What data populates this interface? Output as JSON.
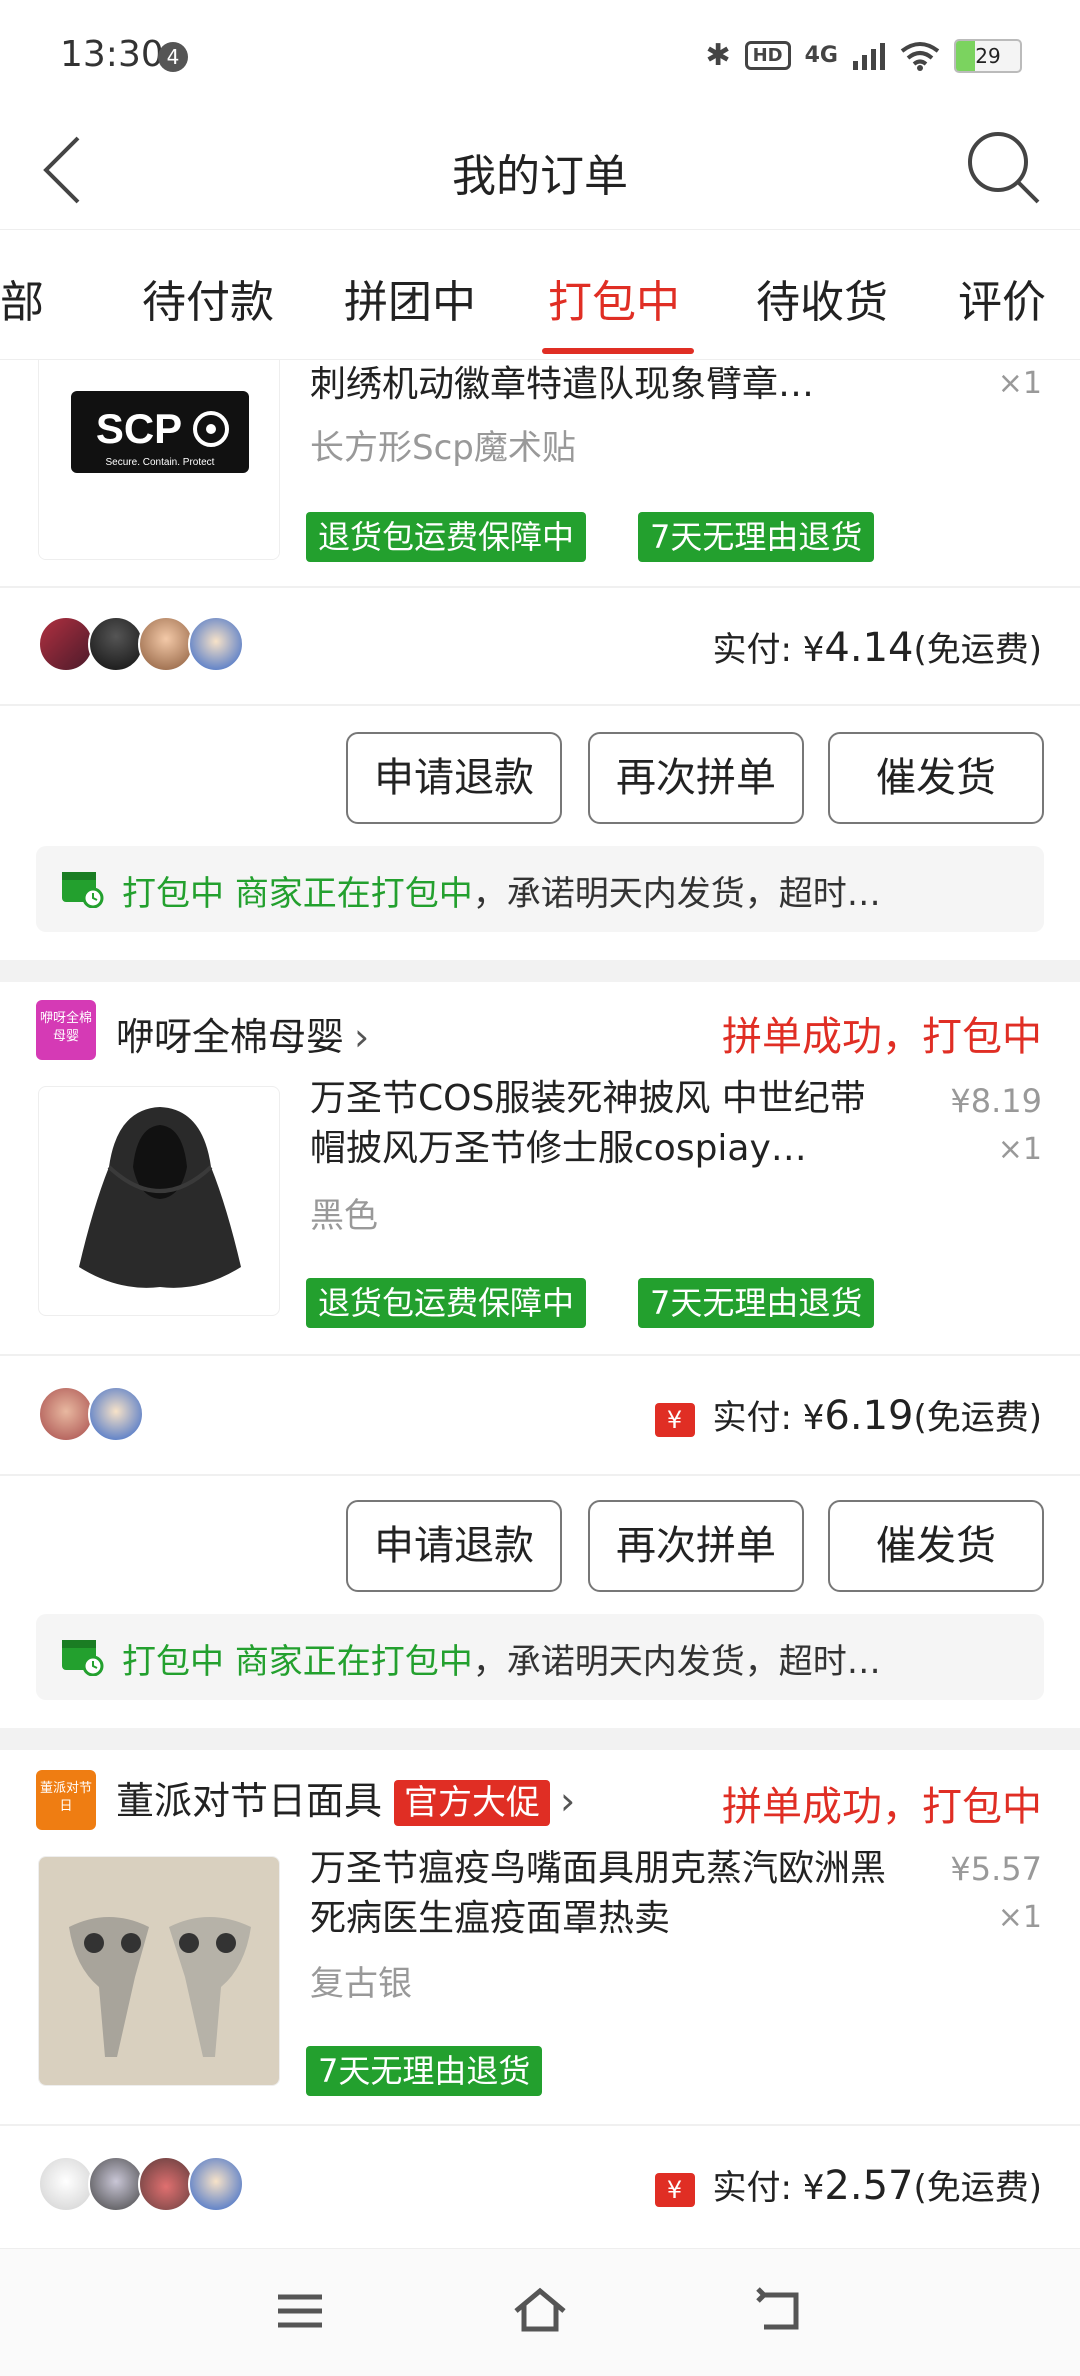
{
  "status_bar": {
    "time": "13:30",
    "notif_count": "4",
    "network": "4G",
    "battery": "29",
    "battery_level": 29
  },
  "header": {
    "title": "我的订单"
  },
  "tabs": [
    "全部",
    "待付款",
    "拼团中",
    "打包中",
    "待收货",
    "评价"
  ],
  "active_tab": "打包中",
  "orders": [
    {
      "title": "刺绣机动徽章特遣队现象臂章…",
      "spec": "长方形Scp魔术贴",
      "qty": "×1",
      "tags": [
        "退货包运费保障中",
        "7天无理由退货"
      ],
      "thumb_text": "SCP",
      "thumb_sub": "Secure. Contain. Protect",
      "paid_prefix": "实付: ¥",
      "paid_amount": "4.14",
      "paid_suffix": "(免运费)",
      "buttons": [
        "申请退款",
        "再次拼单",
        "催发货"
      ],
      "notice_status": "打包中",
      "notice_detail": "商家正在打包中",
      "notice_rest": "，承诺明天内发货，超时…"
    },
    {
      "shop_logo": "咿呀全棉母婴",
      "shop_name": "咿呀全棉母婴",
      "order_status": "拼单成功，打包中",
      "title": "万圣节COS服装死神披风 中世纪带帽披风万圣节修士服cospiay…",
      "spec": "黑色",
      "price": "¥8.19",
      "qty": "×1",
      "tags": [
        "退货包运费保障中",
        "7天无理由退货"
      ],
      "yuan_badge": "¥",
      "paid_prefix": "实付: ¥",
      "paid_amount": "6.19",
      "paid_suffix": "(免运费)",
      "buttons": [
        "申请退款",
        "再次拼单",
        "催发货"
      ],
      "notice_status": "打包中",
      "notice_detail": "商家正在打包中",
      "notice_rest": "，承诺明天内发货，超时…"
    },
    {
      "shop_logo": "董派对节日",
      "shop_name": "董派对节日面具",
      "shop_promo": "官方大促",
      "order_status": "拼单成功，打包中",
      "title": "万圣节瘟疫鸟嘴面具朋克蒸汽欧洲黑死病医生瘟疫面罩热卖",
      "spec": "复古银",
      "price": "¥5.57",
      "qty": "×1",
      "tags": [
        "7天无理由退货"
      ],
      "yuan_badge": "¥",
      "paid_prefix": "实付: ¥",
      "paid_amount": "2.57",
      "paid_suffix": "(免运费)"
    }
  ],
  "colors": {
    "accent": "#e02e24",
    "green_tag": "#23a02e"
  },
  "icons": [
    "back-arrow-icon",
    "search-icon",
    "bluetooth-icon",
    "wifi-icon",
    "signal-icon",
    "shipping-clock-icon",
    "menu-icon",
    "home-icon",
    "back-nav-icon"
  ]
}
